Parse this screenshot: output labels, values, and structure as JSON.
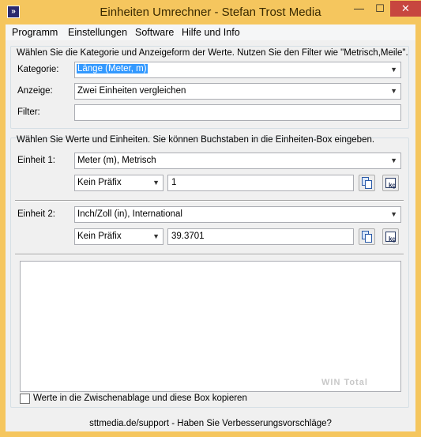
{
  "window": {
    "title": "Einheiten Umrechner - Stefan Trost Media",
    "minimize_glyph": "—",
    "maximize_glyph": "☐",
    "close_glyph": "✕",
    "app_icon": "double-arrow-icon",
    "accent_color": "#f5c65e",
    "close_color": "#c7463f"
  },
  "menu": {
    "items": [
      "Programm",
      "Einstellungen",
      "Software",
      "Hilfe und Info"
    ]
  },
  "category_group": {
    "hint": "Wählen Sie die Kategorie und Anzeigeform der Werte. Nutzen Sie den Filter wie \"Metrisch,Meile\".",
    "kategorie_label": "Kategorie:",
    "kategorie_value": "Länge (Meter, m)",
    "anzeige_label": "Anzeige:",
    "anzeige_value": "Zwei Einheiten vergleichen",
    "filter_label": "Filter:",
    "filter_value": ""
  },
  "values_group": {
    "hint": "Wählen Sie Werte und Einheiten. Sie können Buchstaben in die Einheiten-Box eingeben.",
    "unit1": {
      "label": "Einheit 1:",
      "unit": "Meter (m), Metrisch",
      "prefix": "Kein Präfix",
      "value": "1"
    },
    "unit2": {
      "label": "Einheit 2:",
      "unit": "Inch/Zoll (in), International",
      "prefix": "Kein Präfix",
      "value": "39.3701"
    },
    "copy_icon": "copy-icon",
    "unit_icon": "unit-kg-icon"
  },
  "output": {
    "text": "",
    "watermark": "WIN Total"
  },
  "checkbox": {
    "label": "Werte in die Zwischenablage und diese Box kopieren",
    "checked": false
  },
  "status": {
    "text": "sttmedia.de/support - Haben Sie Verbesserungsvorschläge?"
  }
}
